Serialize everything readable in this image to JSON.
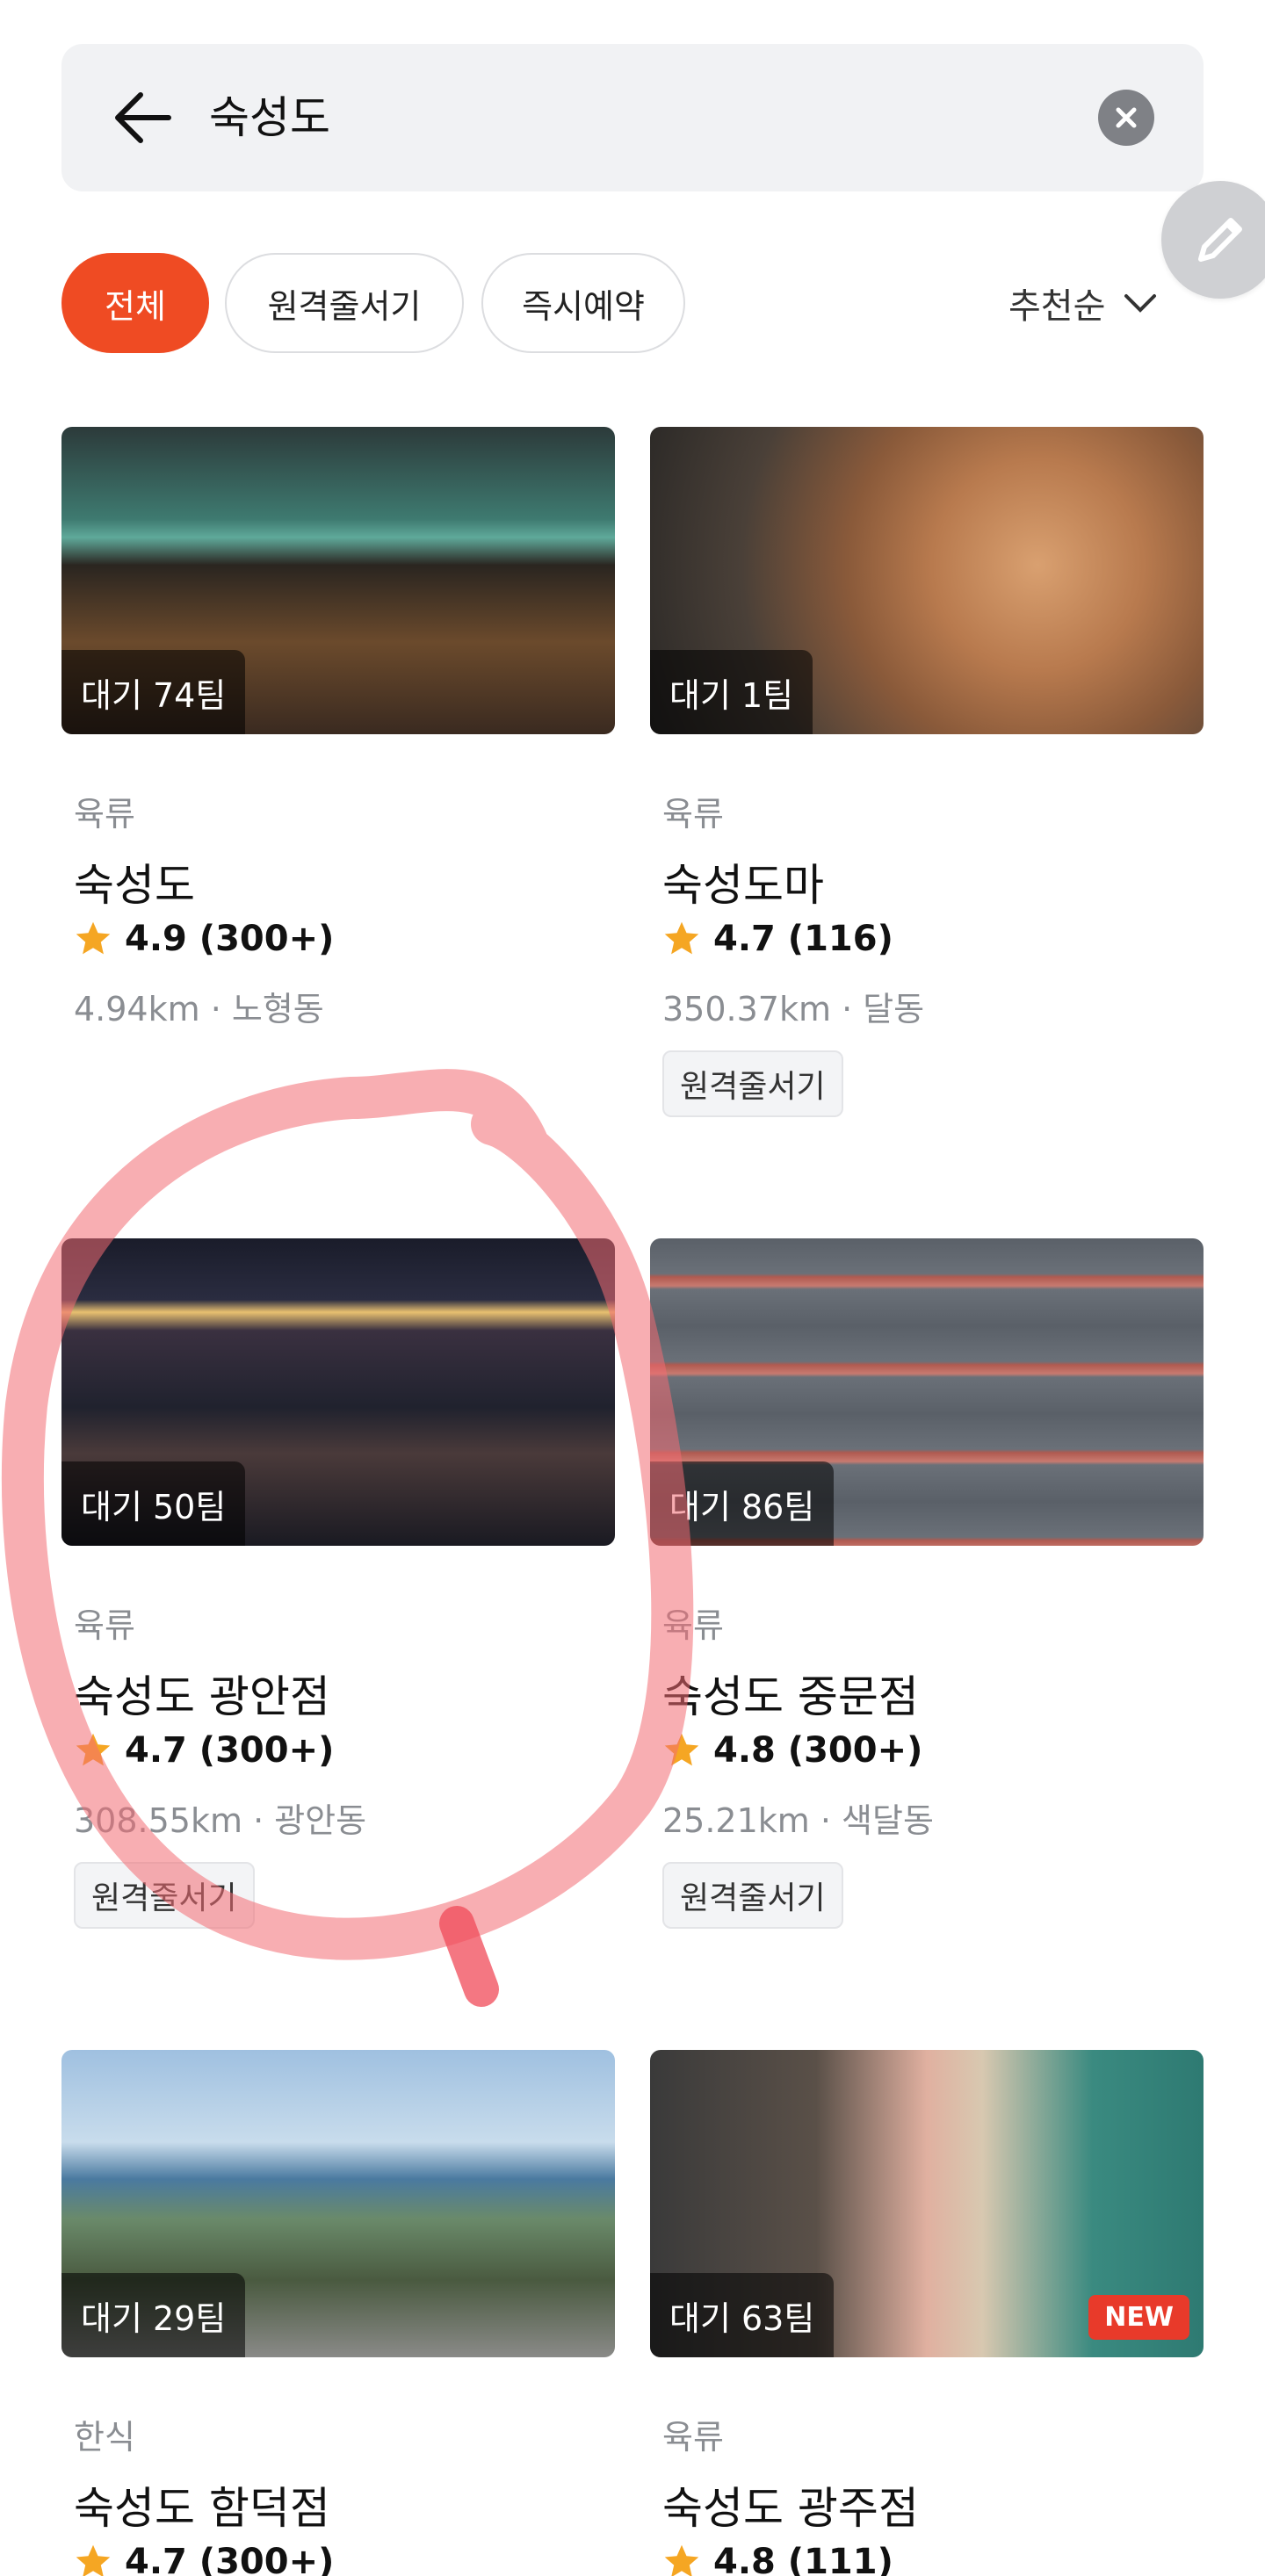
{
  "search": {
    "query": "숙성도"
  },
  "filters": {
    "chips": [
      "전체",
      "원격줄서기",
      "즉시예약"
    ],
    "sort": "추천순"
  },
  "colors": {
    "accent": "#ef4b23",
    "star": "#f5a623",
    "tag_bg": "#f3f4f6"
  },
  "icons": [
    "back-arrow-icon",
    "clear-icon",
    "pencil-icon",
    "chevron-down-icon",
    "star-icon"
  ],
  "results": [
    {
      "wait": "대기 74팀",
      "category": "육류",
      "name": "숙성도",
      "rating": "4.9 (300+)",
      "distance": "4.94km · 노형동",
      "tag": ""
    },
    {
      "wait": "대기 1팀",
      "category": "육류",
      "name": "숙성도마",
      "rating": "4.7 (116)",
      "distance": "350.37km · 달동",
      "tag": "원격줄서기"
    },
    {
      "wait": "대기 50팀",
      "category": "육류",
      "name": "숙성도 광안점",
      "rating": "4.7 (300+)",
      "distance": "308.55km · 광안동",
      "tag": "원격줄서기"
    },
    {
      "wait": "대기 86팀",
      "category": "육류",
      "name": "숙성도 중문점",
      "rating": "4.8 (300+)",
      "distance": "25.21km · 색달동",
      "tag": "원격줄서기"
    },
    {
      "wait": "대기 29팀",
      "category": "한식",
      "name": "숙성도 함덕점",
      "rating": "4.7 (300+)",
      "distance": "",
      "tag": ""
    },
    {
      "wait": "대기 63팀",
      "category": "육류",
      "name": "숙성도 광주점",
      "rating": "4.8 (111)",
      "distance": "",
      "tag": "",
      "badge": "NEW"
    }
  ]
}
